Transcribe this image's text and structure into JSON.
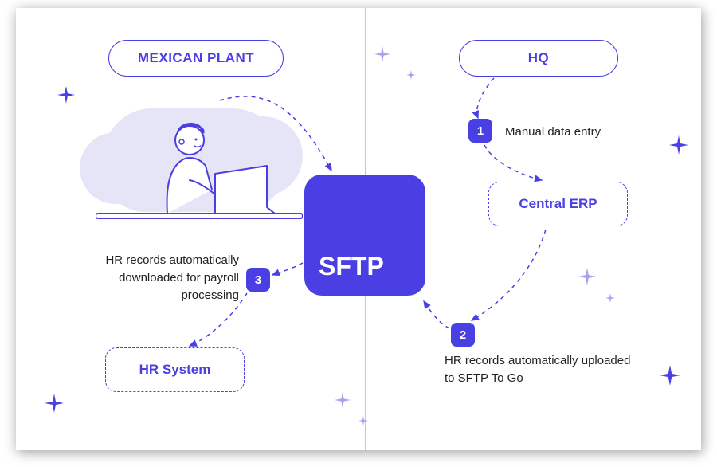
{
  "left": {
    "title": "MEXICAN PLANT",
    "hr_box": "HR System",
    "step3_num": "3",
    "step3_text": "HR records automatically downloaded for payroll processing"
  },
  "right": {
    "title": "HQ",
    "erp_box": "Central ERP",
    "step1_num": "1",
    "step1_text": "Manual data entry",
    "step2_num": "2",
    "step2_text": "HR records automatically uploaded to SFTP To Go"
  },
  "center": {
    "sftp_label": "SFTP"
  }
}
